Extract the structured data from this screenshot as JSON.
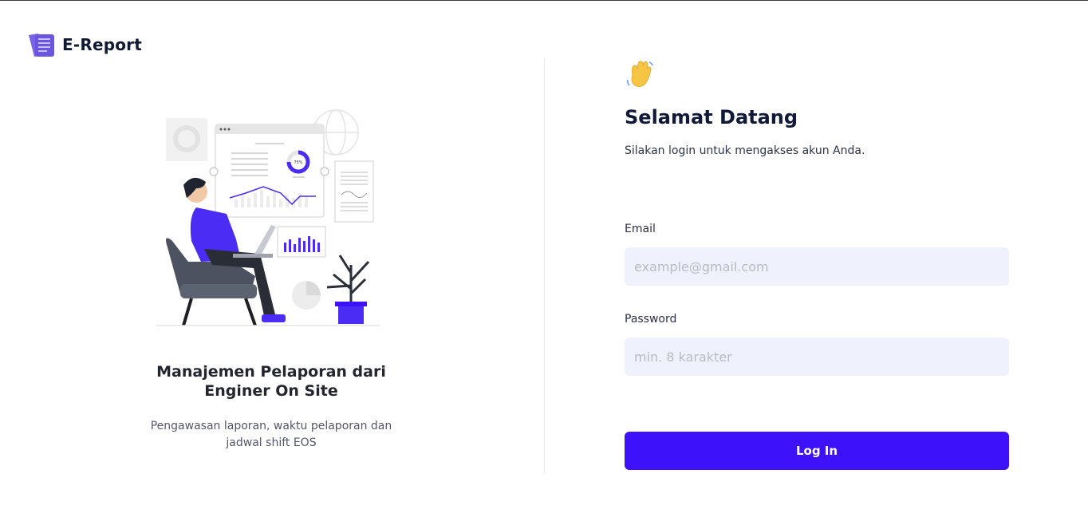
{
  "brand": {
    "name": "E-Report"
  },
  "left": {
    "title": "Manajemen Pelaporan dari Enginer On Site",
    "subtitle": "Pengawasan laporan, waktu pelaporan dan jadwal shift EOS",
    "chart_badge": "75%"
  },
  "right": {
    "greeting_icon": "waving-hand-icon",
    "title": "Selamat Datang",
    "subtitle": "Silakan login untuk mengakses akun Anda."
  },
  "form": {
    "email_label": "Email",
    "email_placeholder": "example@gmail.com",
    "password_label": "Password",
    "password_placeholder": "min. 8 karakter",
    "login_label": "Log In"
  },
  "colors": {
    "accent": "#3d12fb",
    "input_bg": "#eff2fc",
    "heading": "#101938"
  }
}
